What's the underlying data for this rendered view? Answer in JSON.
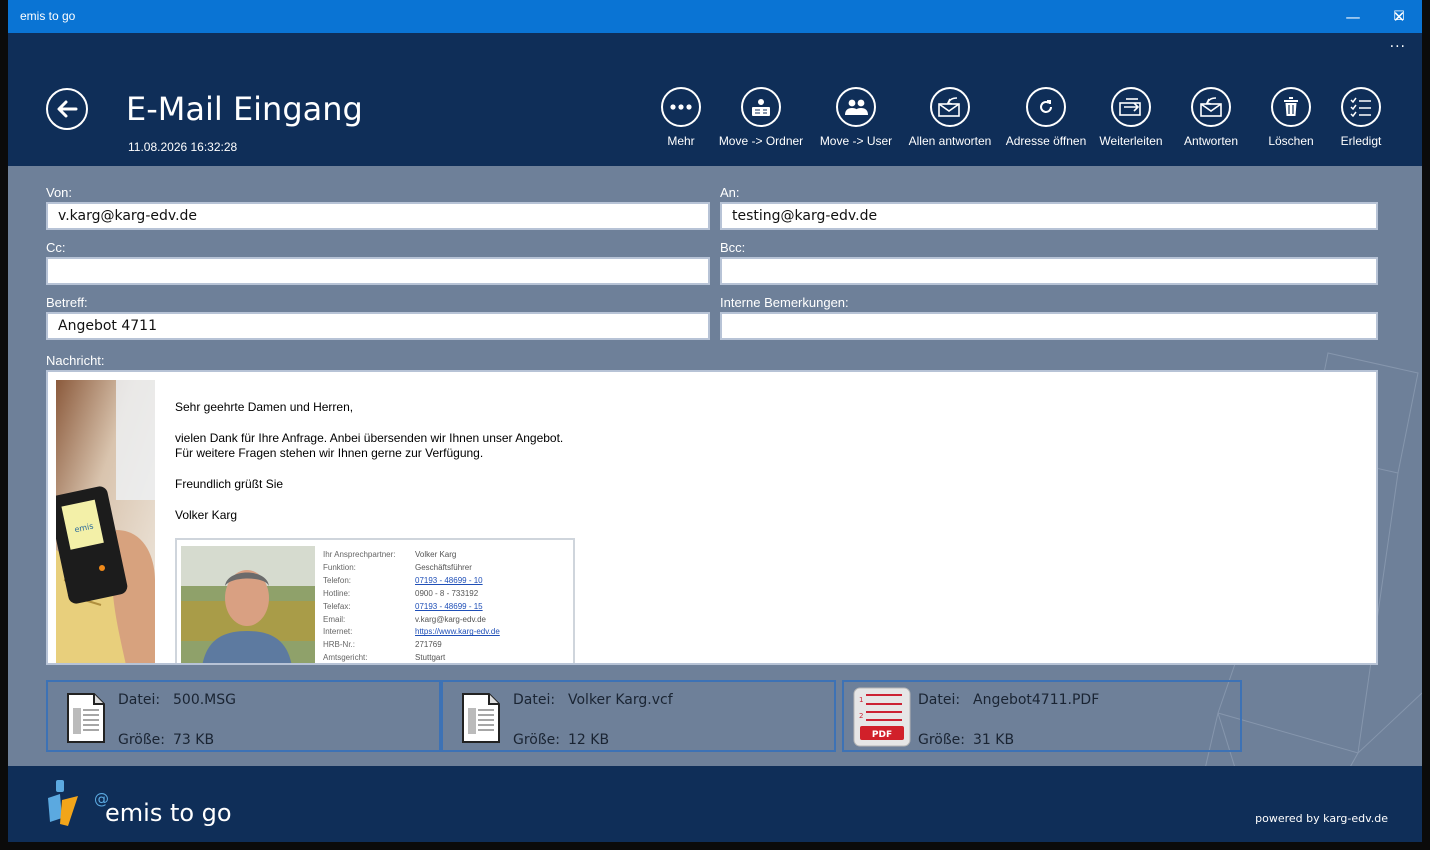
{
  "window": {
    "title": "emis to go",
    "minimize": "—",
    "maximize": "☐",
    "close": "✕"
  },
  "header": {
    "title": "E-Mail Eingang",
    "timestamp": "11.08.2026 16:32:28",
    "more_dots": "...",
    "toolbar": [
      {
        "label": "Mehr",
        "icon": "more-icon"
      },
      {
        "label": "Move -> Ordner",
        "icon": "move-folder-icon"
      },
      {
        "label": "Move -> User",
        "icon": "move-user-icon"
      },
      {
        "label": "Allen antworten",
        "icon": "reply-all-icon"
      },
      {
        "label": "Adresse öffnen",
        "icon": "open-address-icon"
      },
      {
        "label": "Weiterleiten",
        "icon": "forward-icon"
      },
      {
        "label": "Antworten",
        "icon": "reply-icon"
      },
      {
        "label": "Löschen",
        "icon": "delete-icon"
      },
      {
        "label": "Erledigt",
        "icon": "done-icon"
      }
    ]
  },
  "form": {
    "von_label": "Von:",
    "von_value": "v.karg@karg-edv.de",
    "an_label": "An:",
    "an_value": "testing@karg-edv.de",
    "cc_label": "Cc:",
    "cc_value": "",
    "bcc_label": "Bcc:",
    "bcc_value": "",
    "betreff_label": "Betreff:",
    "betreff_value": "Angebot 4711",
    "bemerkungen_label": "Interne Bemerkungen:",
    "bemerkungen_value": "",
    "nachricht_label": "Nachricht:"
  },
  "message": {
    "greeting": "Sehr geehrte Damen und Herren,",
    "line1": "vielen Dank für Ihre Anfrage. Anbei übersenden wir Ihnen unser Angebot.",
    "line2": "Für weitere Fragen stehen wir Ihnen gerne zur Verfügung.",
    "closing": "Freundlich grüßt Sie",
    "name": "Volker Karg",
    "phone_brand": "emis",
    "signature": [
      {
        "key": "Ihr Ansprechpartner:",
        "value": "Volker Karg",
        "link": false
      },
      {
        "key": "Funktion:",
        "value": "Geschäftsführer",
        "link": false
      },
      {
        "key": "Telefon:",
        "value": "07193 - 48699 - 10",
        "link": true
      },
      {
        "key": "Hotline:",
        "value": "0900 - 8 - 733192",
        "link": false
      },
      {
        "key": "Telefax:",
        "value": "07193 - 48699 - 15",
        "link": true
      },
      {
        "key": "Email:",
        "value": "v.karg@karg-edv.de",
        "link": false
      },
      {
        "key": "Internet:",
        "value": "https://www.karg-edv.de",
        "link": true
      },
      {
        "key": "HRB-Nr.:",
        "value": "271769",
        "link": false
      },
      {
        "key": "Amtsgericht:",
        "value": "Stuttgart",
        "link": false
      }
    ]
  },
  "attachments": [
    {
      "datei_label": "Datei:",
      "name": "500.MSG",
      "size_label": "Größe:",
      "size": "73 KB",
      "type": "msg"
    },
    {
      "datei_label": "Datei:",
      "name": "Volker Karg.vcf",
      "size_label": "Größe:",
      "size": "12 KB",
      "type": "vcf"
    },
    {
      "datei_label": "Datei:",
      "name": "Angebot4711.PDF",
      "size_label": "Größe:",
      "size": "31 KB",
      "type": "pdf",
      "badge": "PDF"
    }
  ],
  "footer": {
    "brand": "emis to go",
    "brand_at": "@",
    "powered": "powered by karg-edv.de"
  }
}
